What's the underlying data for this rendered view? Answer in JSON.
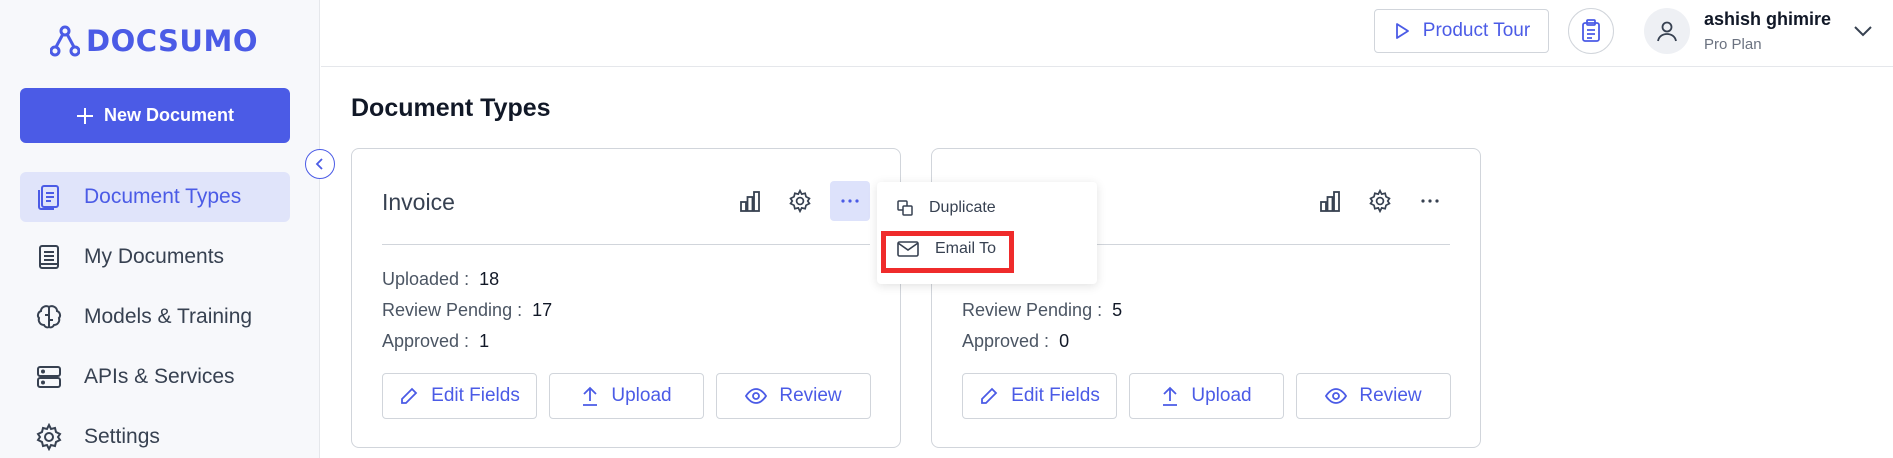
{
  "brand": {
    "name": "DOCSUMO",
    "accent": "#4b5be6"
  },
  "sidebar": {
    "new_document_label": "New Document",
    "items": [
      {
        "label": "Document Types",
        "icon": "document-types-icon",
        "active": true
      },
      {
        "label": "My Documents",
        "icon": "my-documents-icon",
        "active": false
      },
      {
        "label": "Models & Training",
        "icon": "brain-icon",
        "active": false
      },
      {
        "label": "APIs & Services",
        "icon": "server-icon",
        "active": false
      },
      {
        "label": "Settings",
        "icon": "gear-icon",
        "active": false
      }
    ]
  },
  "topbar": {
    "product_tour_label": "Product Tour",
    "user": {
      "name": "ashish ghimire",
      "plan": "Pro Plan"
    }
  },
  "main": {
    "title": "Document Types",
    "cards": [
      {
        "title": "Invoice",
        "stats": [
          {
            "label": "Uploaded :",
            "value": "18"
          },
          {
            "label": "Review Pending :",
            "value": "17"
          },
          {
            "label": "Approved :",
            "value": "1"
          }
        ],
        "buttons": [
          "Edit Fields",
          "Upload",
          "Review"
        ]
      },
      {
        "title": "",
        "stats": [
          {
            "label": "",
            "value": ""
          },
          {
            "label": "Review Pending :",
            "value": "5"
          },
          {
            "label": "Approved :",
            "value": "0"
          }
        ],
        "buttons": [
          "Edit Fields",
          "Upload",
          "Review"
        ]
      }
    ]
  },
  "dropdown": {
    "items": [
      {
        "label": "Duplicate",
        "icon": "duplicate-icon"
      },
      {
        "label": "Email To",
        "icon": "mail-icon",
        "highlighted": true
      }
    ],
    "highlight_color": "#ef2b2b"
  }
}
